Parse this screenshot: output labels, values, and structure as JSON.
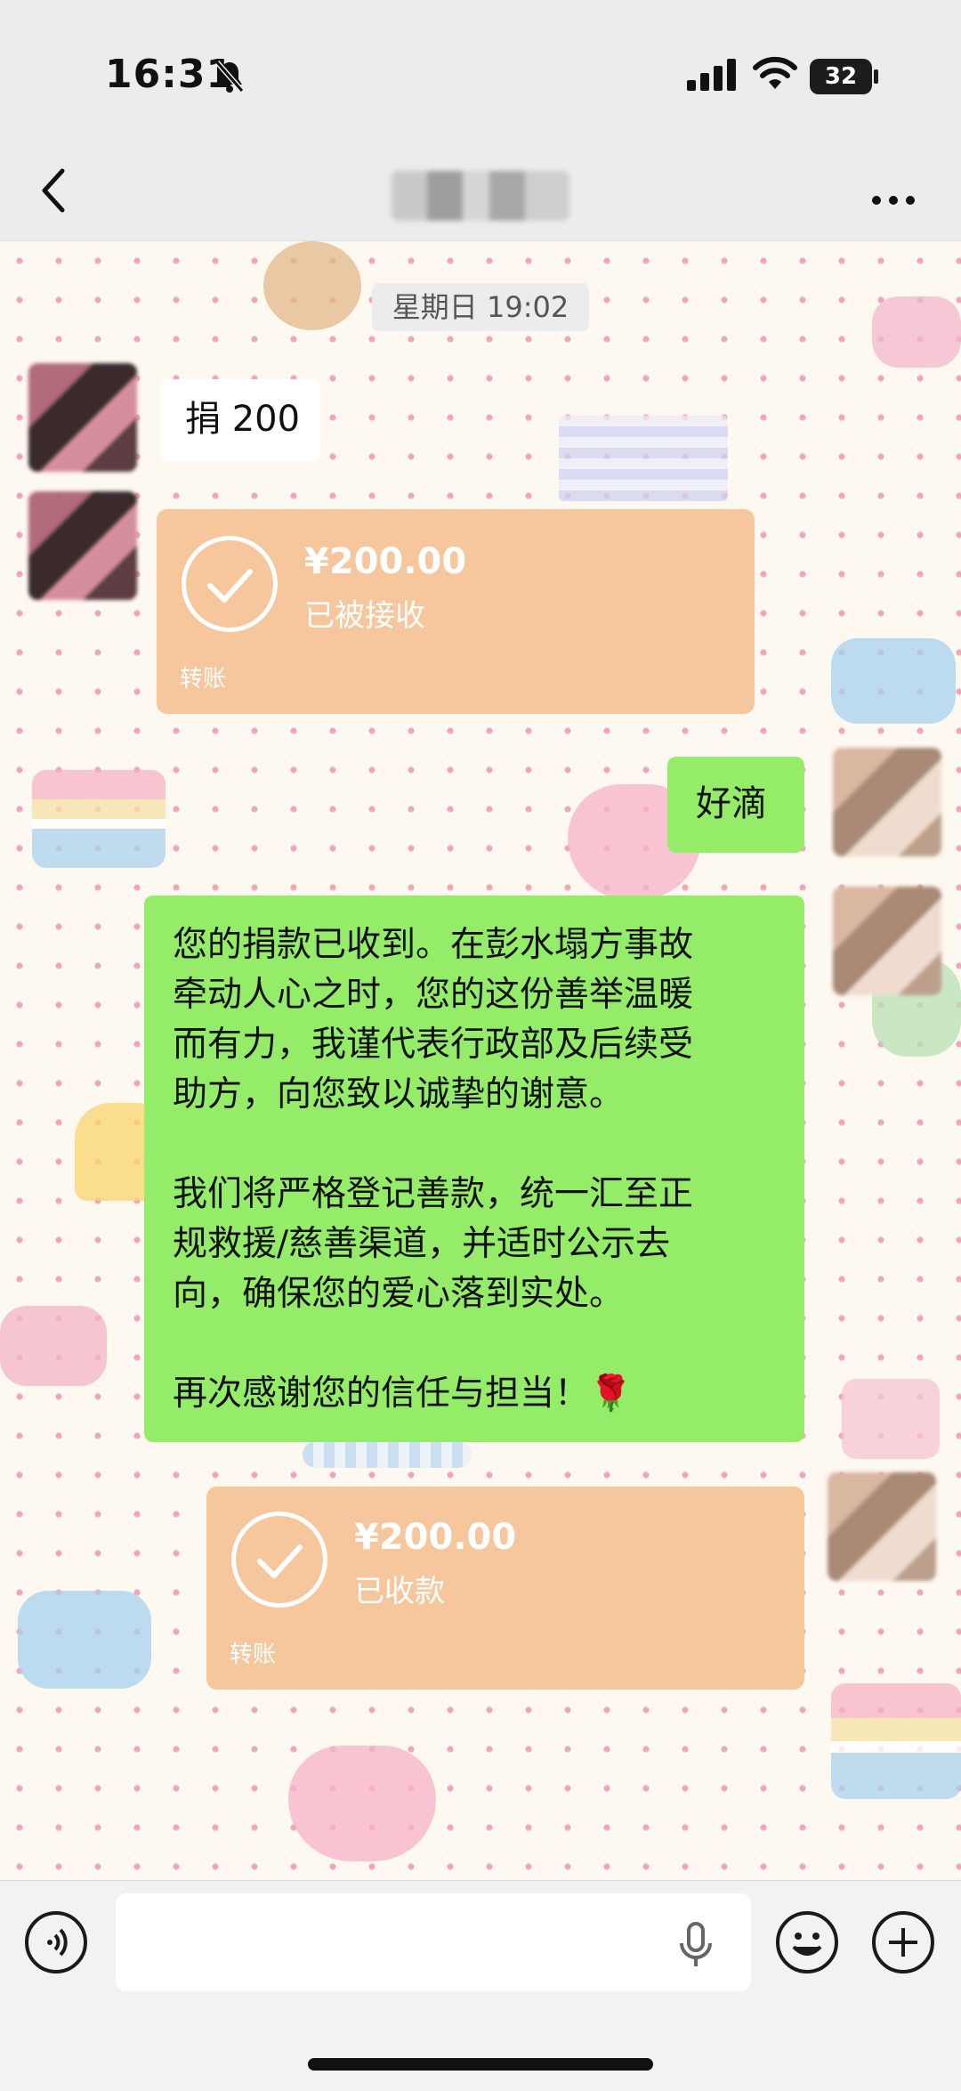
{
  "status_bar": {
    "time": "16:31",
    "battery": "32"
  },
  "chat": {
    "timestamp": "星期日 19:02",
    "messages": [
      {
        "side": "left",
        "type": "text",
        "text": "捐 200"
      },
      {
        "side": "left",
        "type": "transfer",
        "amount": "¥200.00",
        "status": "已被接收",
        "label": "转账"
      },
      {
        "side": "right",
        "type": "text",
        "text": "好滴"
      },
      {
        "side": "right",
        "type": "text",
        "paragraph1": [
          "您的捐款已收到。在彭水塌方事故",
          "牵动人心之时，您的这份善举温暖",
          "而有力，我谨代表行政部及后续受",
          "助方，向您致以诚挚的谢意。"
        ],
        "paragraph2": [
          "我们将严格登记善款，统一汇至正",
          "规救援/慈善渠道，并适时公示去",
          "向，确保您的爱心落到实处。"
        ],
        "paragraph3": "再次感谢您的信任与担当！",
        "emoji": "🌹"
      },
      {
        "side": "right",
        "type": "transfer",
        "amount": "¥200.00",
        "status": "已收款",
        "label": "转账"
      }
    ]
  },
  "icons": {
    "back": "chevron-left-icon",
    "more": "more-dots-icon",
    "voice": "voice-icon",
    "mic": "mic-icon",
    "emoji": "emoji-icon",
    "plus": "plus-icon"
  },
  "colors": {
    "green_bubble": "#95ec69",
    "transfer_card": "#f6c79c",
    "white_bubble": "#ffffff"
  }
}
